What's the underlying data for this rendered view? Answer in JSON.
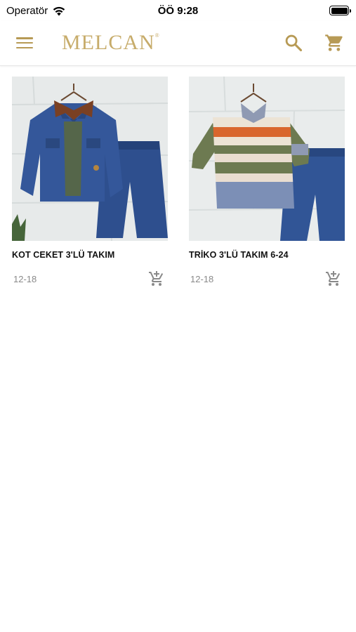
{
  "status_bar": {
    "carrier": "Operatör",
    "time": "ÖÖ 9:28"
  },
  "header": {
    "logo_text": "MELCAN",
    "logo_mark": "®",
    "menu_icon": "hamburger-menu-icon",
    "search_icon": "search-icon",
    "cart_icon": "shopping-cart-icon"
  },
  "colors": {
    "accent": "#b79a55",
    "logo": "#c7ac6b",
    "size_text": "#8a8a8a"
  },
  "products": [
    {
      "title": "KOT CEKET 3'LÜ TAKIM",
      "size": "12-18",
      "image": "denim jacket, green shirt and jeans set",
      "add_icon": "add-to-cart-icon"
    },
    {
      "title": "TRİKO 3'LÜ TAKIM 6-24",
      "size": "12-18",
      "image": "striped sweater, shirt and jeans set",
      "add_icon": "add-to-cart-icon"
    }
  ]
}
